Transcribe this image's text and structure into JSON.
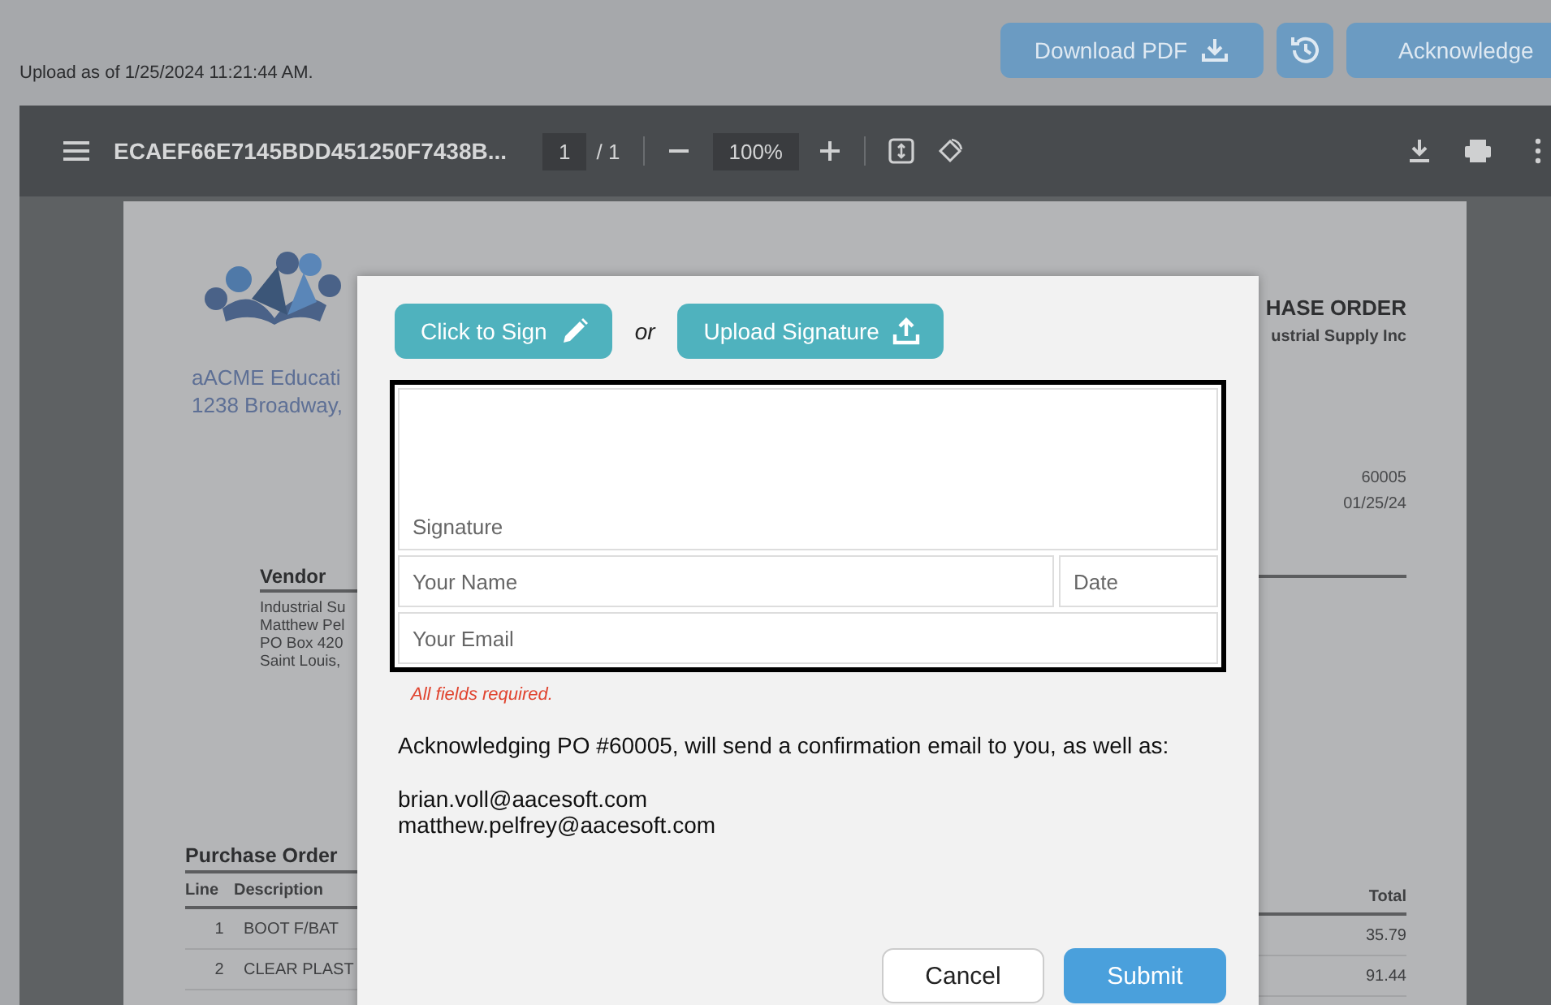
{
  "header": {
    "upload_status": "Upload as of 1/25/2024 11:21:44 AM.",
    "buttons": [
      {
        "kind": "download",
        "label": "Download PDF"
      },
      {
        "kind": "history"
      },
      {
        "kind": "acknowledge",
        "label": "Acknowledge"
      }
    ]
  },
  "viewer": {
    "file_name": "ECAEF66E7145BDD451250F7438B...",
    "page": "1",
    "page_count": "/ 1",
    "zoom": "100%"
  },
  "document": {
    "org_name": "aACME Educati",
    "org_address": "1238 Broadway,",
    "title": "HASE ORDER",
    "supplier": "ustrial Supply Inc",
    "po_number": "60005",
    "po_date": "01/25/24",
    "vendor": {
      "heading": "Vendor",
      "lines": [
        "Industrial Su",
        "Matthew Pel",
        "PO Box 420",
        "Saint Louis,"
      ]
    },
    "items": {
      "heading": "Purchase Order",
      "columns": [
        "Line",
        "Description",
        "Total"
      ],
      "rows": [
        {
          "line": "1",
          "description": "BOOT F/BAT",
          "total": "35.79"
        },
        {
          "line": "2",
          "description": "CLEAR PLAST",
          "total": "91.44"
        }
      ]
    }
  },
  "modal": {
    "sign_button": "Click to Sign",
    "or": "or",
    "upload_button": "Upload Signature",
    "signature_placeholder": "Signature",
    "name_placeholder": "Your Name",
    "date_placeholder": "Date",
    "email_placeholder": "Your Email",
    "validation": "All fields required.",
    "message": "Acknowledging PO #60005, will send a confirmation email to you, as well as:",
    "recipients": [
      "brian.voll@aacesoft.com",
      "matthew.pelfrey@aacesoft.com"
    ],
    "buttons": [
      {
        "kind": "secondary",
        "label": "Cancel"
      },
      {
        "kind": "primary",
        "label": "Submit"
      }
    ]
  }
}
